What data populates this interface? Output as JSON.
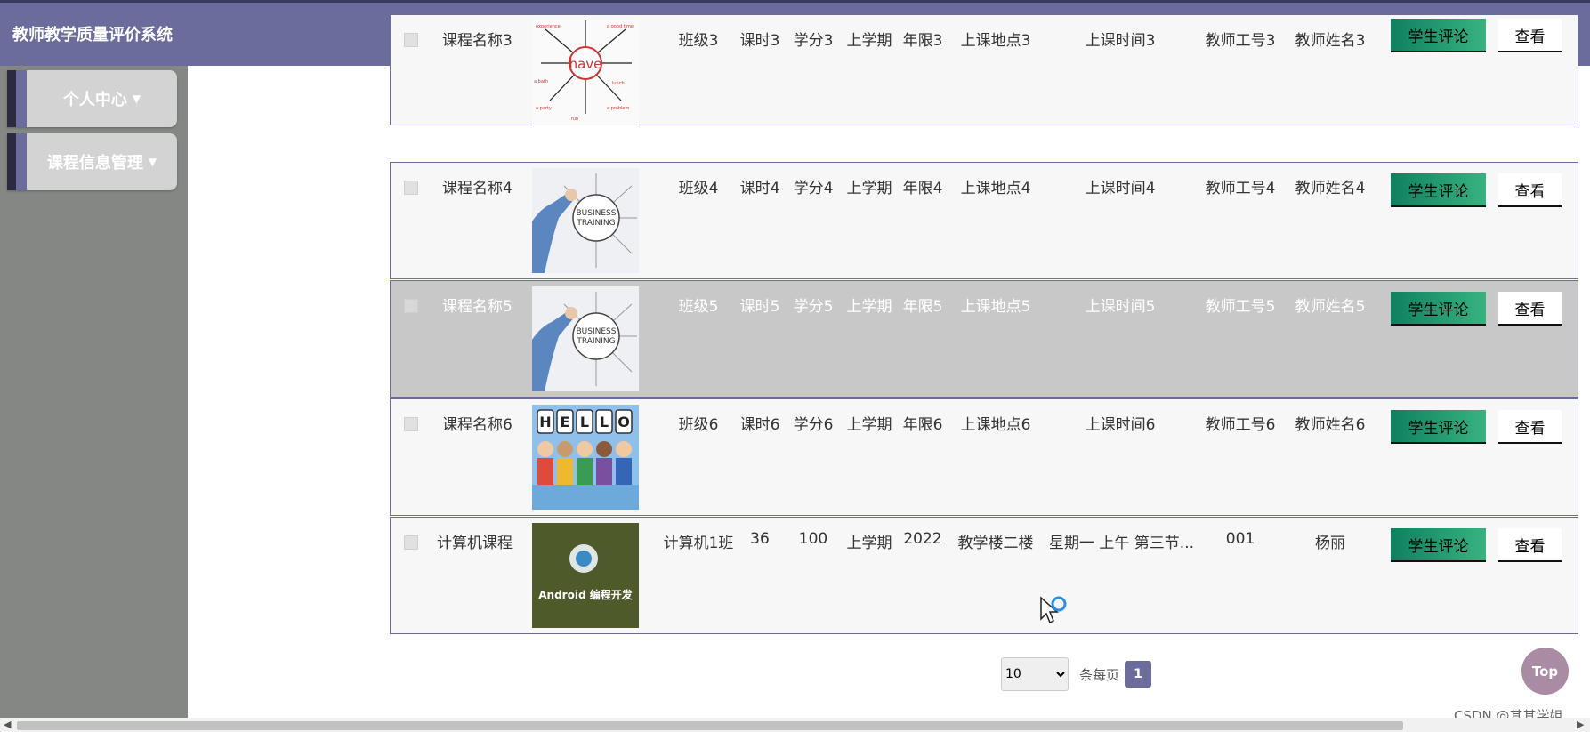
{
  "app": {
    "title": "教师教学质量评价系统"
  },
  "header": {
    "fullscreen_icon": "expand-icon",
    "user_icon": "user-icon"
  },
  "sidebar": {
    "items": [
      {
        "label": "个人中心",
        "icon": "caret-down-icon"
      },
      {
        "label": "课程信息管理",
        "icon": "caret-down-icon"
      }
    ]
  },
  "table": {
    "rows": [
      {
        "name": "课程名称3",
        "image": "have-wordcloud",
        "class": "班级3",
        "hours": "课时3",
        "credit": "学分3",
        "term": "上学期",
        "years": "年限3",
        "location": "上课地点3",
        "time": "上课时间3",
        "teacher_id": "教师工号3",
        "teacher_name": "教师姓名3",
        "eval_label": "学生评论",
        "view_label": "查看"
      },
      {
        "name": "课程名称4",
        "image": "business-training",
        "class": "班级4",
        "hours": "课时4",
        "credit": "学分4",
        "term": "上学期",
        "years": "年限4",
        "location": "上课地点4",
        "time": "上课时间4",
        "teacher_id": "教师工号4",
        "teacher_name": "教师姓名4",
        "eval_label": "学生评论",
        "view_label": "查看"
      },
      {
        "name": "课程名称5",
        "image": "business-training",
        "class": "班级5",
        "hours": "课时5",
        "credit": "学分5",
        "term": "上学期",
        "years": "年限5",
        "location": "上课地点5",
        "time": "上课时间5",
        "teacher_id": "教师工号5",
        "teacher_name": "教师姓名5",
        "eval_label": "学生评论",
        "view_label": "查看"
      },
      {
        "name": "课程名称6",
        "image": "hello-people",
        "class": "班级6",
        "hours": "课时6",
        "credit": "学分6",
        "term": "上学期",
        "years": "年限6",
        "location": "上课地点6",
        "time": "上课时间6",
        "teacher_id": "教师工号6",
        "teacher_name": "教师姓名6",
        "eval_label": "学生评论",
        "view_label": "查看"
      },
      {
        "name": "计算机课程",
        "image": "android-dev",
        "image_caption": "Android 编程开发",
        "class": "计算机1班",
        "hours": "36",
        "credit": "100",
        "term": "上学期",
        "years": "2022",
        "location": "教学楼二楼",
        "time": "星期一 上午 第三节...",
        "teacher_id": "001",
        "teacher_name": "杨丽",
        "eval_label": "学生评论",
        "view_label": "查看"
      }
    ]
  },
  "pagination": {
    "page_size": "10",
    "page_size_options": [
      "10"
    ],
    "per_page_label": "条每页",
    "current_page": "1"
  },
  "top_button": {
    "label": "Top"
  },
  "watermark": {
    "text": "CSDN @其其学姐"
  },
  "colors": {
    "header": "#6b6c9b",
    "sidebar": "#848784",
    "eval_button": "#0f8060",
    "accent": "#4a1737"
  }
}
